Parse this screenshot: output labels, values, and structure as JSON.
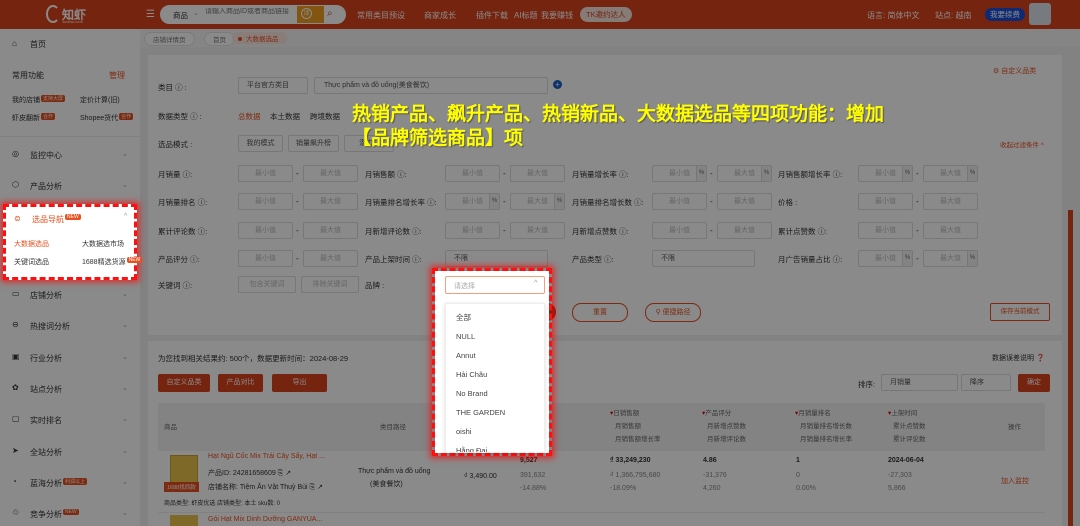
{
  "topbar": {
    "logo": "知虾",
    "logo_sub": "SHOPEE DATA",
    "search_type": "商品",
    "search_placeholder": "请输入商品ID或者商品链接",
    "nav": [
      "常用类目预设",
      "商家成长",
      "插件下载",
      "AI标题",
      "我要赚钱"
    ],
    "tk_pill": "TK邀约达人",
    "language": "语言: 简体中文",
    "site": "站点: 越南",
    "renew": "我要续费",
    "brand_color": "#d9441c"
  },
  "tabs": [
    "店铺详情页",
    "首页",
    "大数据选品"
  ],
  "sidebar": {
    "home": "首页",
    "common": "常用功能",
    "manage": "管理",
    "shortcuts": [
      {
        "label": "我的店铺",
        "badge": "支持大屏"
      },
      {
        "label": "定价计算(旧)"
      },
      {
        "label": "虾皮翻新",
        "badge": "合作"
      },
      {
        "label": "Shopee货代",
        "badge": "合作"
      }
    ],
    "menu_top": [
      "监控中心",
      "产品分析"
    ],
    "nav_group": {
      "label": "选品导航",
      "badge": "NEW",
      "items": [
        "大数据选品",
        "大数据选市场",
        "关键词选品",
        "1688精选货源"
      ],
      "item_badge": "NEW"
    },
    "menu": [
      {
        "label": "店铺分析"
      },
      {
        "label": "热搜词分析"
      },
      {
        "label": "行业分析"
      },
      {
        "label": "站点分析"
      },
      {
        "label": "实时排名"
      },
      {
        "label": "全站分析"
      },
      {
        "label": "蓝海分析",
        "badge": "利润以上"
      },
      {
        "label": "竞争分析",
        "badge": "NEW"
      }
    ]
  },
  "filters": {
    "custom_category": "自定义品类",
    "collapse": "收起过滤条件 ^",
    "category_label": "类目 ⓘ :",
    "category_type": "平台官方类目",
    "category_value": "Thực phẩm và đồ uống(美食餐饮)",
    "data_type_label": "数据类型 ⓘ :",
    "data_types": [
      "总数据",
      "本土数据",
      "跨境数据"
    ],
    "mode_label": "选品模式 :",
    "modes": [
      "我的模式",
      "销量飙升榜",
      "潜力..."
    ],
    "min": "最小值",
    "max": "最大值",
    "pct": "%",
    "unlimited": "不限",
    "kw_include": "包含关键词",
    "kw_exclude": "排除关键词",
    "rows": [
      [
        {
          "label": "月销量 ⓘ:"
        },
        {
          "label": "月销售额 ⓘ:"
        },
        {
          "label": "月销量增长率 ⓘ:",
          "pct": true
        },
        {
          "label": "月销售额增长率 ⓘ:",
          "pct": true
        }
      ],
      [
        {
          "label": "月销量排名 ⓘ:"
        },
        {
          "label": "月销量排名增长率 ⓘ:",
          "pct": true
        },
        {
          "label": "月销量排名增长数 ⓘ:"
        },
        {
          "label": "价格 :"
        }
      ],
      [
        {
          "label": "累计评论数 ⓘ:"
        },
        {
          "label": "月新增评论数 ⓘ:"
        },
        {
          "label": "月新增点赞数 ⓘ:"
        },
        {
          "label": "累计点赞数 ⓘ:"
        }
      ],
      [
        {
          "label": "产品评分 ⓘ:"
        },
        {
          "label": "产品上架时间 ⓘ:",
          "select": true
        },
        {
          "label": "产品类型 ⓘ:",
          "select": true
        },
        {
          "label": "月广告销量占比 ⓘ:",
          "pct": true
        }
      ]
    ],
    "keyword_label": "关键词 ⓘ:",
    "brand_label": "品牌 :",
    "brand_placeholder": "请选择",
    "brand_options": [
      "全部",
      "NULL",
      "Annut",
      "Hải Châu",
      "No Brand",
      "THE GARDEN",
      "oishi",
      "Hằng Đại"
    ],
    "reset": "重置",
    "shortcut_path": "便捷路径",
    "save_mode": "保存当前模式"
  },
  "annotation": {
    "line1": "热销产品、飙升产品、热销新品、大数据选品等四项功能：增加",
    "line2": "【品牌筛选商品】项"
  },
  "results": {
    "summary": "为您找到相关结果约: 500个，数据更新时间：2024-08-29",
    "error_note": "数据误差说明",
    "buttons": [
      "自定义品类",
      "产品对比",
      "导出"
    ],
    "sort_label": "排序:",
    "sort_field": "月销量",
    "sort_order": "降序",
    "confirm": "确定",
    "headers": {
      "product": "商品",
      "category": "类目路径",
      "daily_sales": [
        "日销售额",
        "月销售额",
        "月销售额增长率"
      ],
      "rating": [
        "产品评分",
        "月新增点赞数",
        "月新增评论数"
      ],
      "rank": [
        "月销量排名",
        "月销量排名增长数",
        "月销量排名增长率"
      ],
      "listed": [
        "上架时间",
        "累计点赞数",
        "累计评论数"
      ],
      "action": "操作"
    },
    "rows": [
      {
        "title": "Hạt Ngũ Cốc Mix Trái Cây Sấy, Hạt ...",
        "id_label": "产品ID:",
        "id": "24281658609",
        "shop_label": "店铺名称:",
        "shop": "Tiệm Ăn Vặt Thuỳ Bùi",
        "tag": "1688找同款",
        "meta": "商品类型: 虾皮优选   店铺类型: 本土   sku数: 0",
        "category": "Thực phẩm và đồ uống",
        "category2": "(美食餐饮)",
        "price": "₫ 3,490.00",
        "c1": [
          "9,527",
          "391,632",
          "-14.88%"
        ],
        "sales": [
          "₫ 33,249,230",
          "₫ 1,366,795,680",
          "-18.09%"
        ],
        "rating": [
          "4.86",
          "-31,376",
          "4,260"
        ],
        "rank": [
          "1",
          "0",
          "0.00%"
        ],
        "listed": [
          "2024-06-04",
          "-27,303",
          "5,866"
        ],
        "action": "加入监控"
      },
      {
        "title": "Gói Hạt Mix Dinh Dưỡng GANYUA..."
      }
    ]
  }
}
